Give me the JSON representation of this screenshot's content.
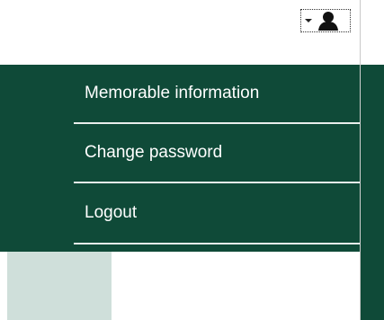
{
  "header": {
    "user_menu": {
      "icon": "user-silhouette-icon",
      "caret": "caret-down-icon"
    }
  },
  "dropdown": {
    "items": [
      {
        "label": "Memorable information"
      },
      {
        "label": "Change password"
      },
      {
        "label": "Logout"
      }
    ]
  },
  "colors": {
    "brand_green": "#0f4a38",
    "divider": "#e8eeec",
    "light_panel": "#cfdfda"
  }
}
